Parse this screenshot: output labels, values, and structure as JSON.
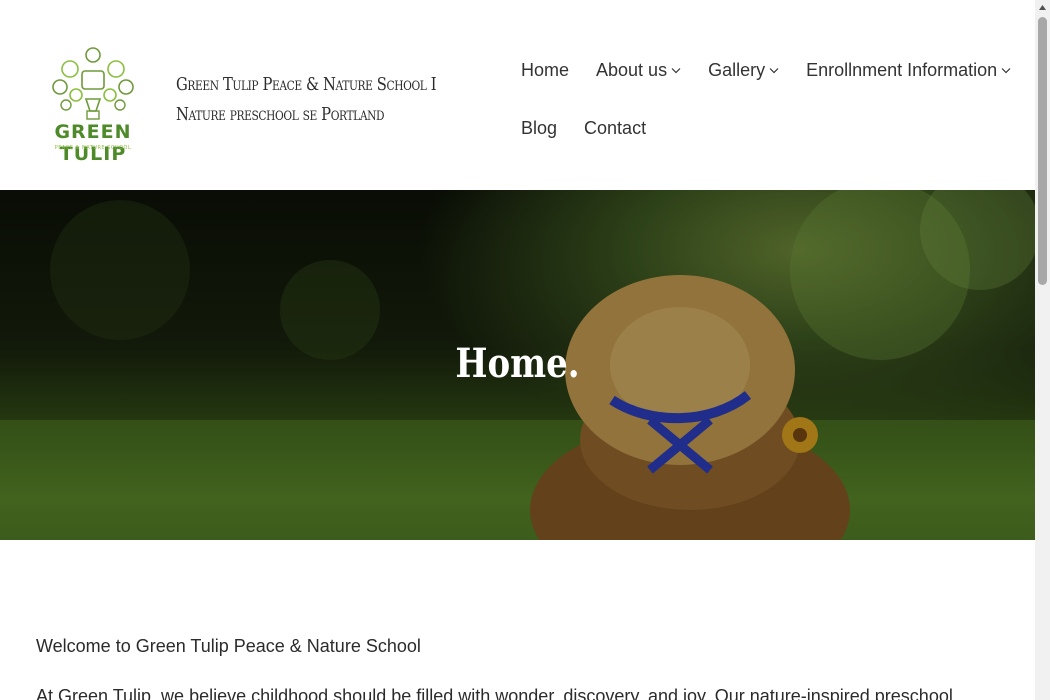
{
  "header": {
    "logo_text": "GREEN TULIP",
    "logo_subtext": "PEACE & NATURE SCHOOL",
    "site_title": "Green Tulip Peace & Nature School I Nature preschool se Portland"
  },
  "nav": {
    "items": [
      {
        "label": "Home",
        "has_dropdown": false
      },
      {
        "label": "About us",
        "has_dropdown": true
      },
      {
        "label": "Gallery",
        "has_dropdown": true
      },
      {
        "label": "Enrollnment Information",
        "has_dropdown": true
      },
      {
        "label": "Blog",
        "has_dropdown": false
      },
      {
        "label": "Contact",
        "has_dropdown": false
      }
    ]
  },
  "hero": {
    "title": "Home."
  },
  "content": {
    "welcome": "Welcome to Green Tulip Peace & Nature School",
    "paragraph_start": "At Green Tulip, we believe childhood should be filled with wonder, discovery, and joy. Our nature-inspired preschool"
  },
  "colors": {
    "logo_green": "#8cbf3f",
    "logo_dark_green": "#4e8a2a",
    "text": "#333333"
  }
}
